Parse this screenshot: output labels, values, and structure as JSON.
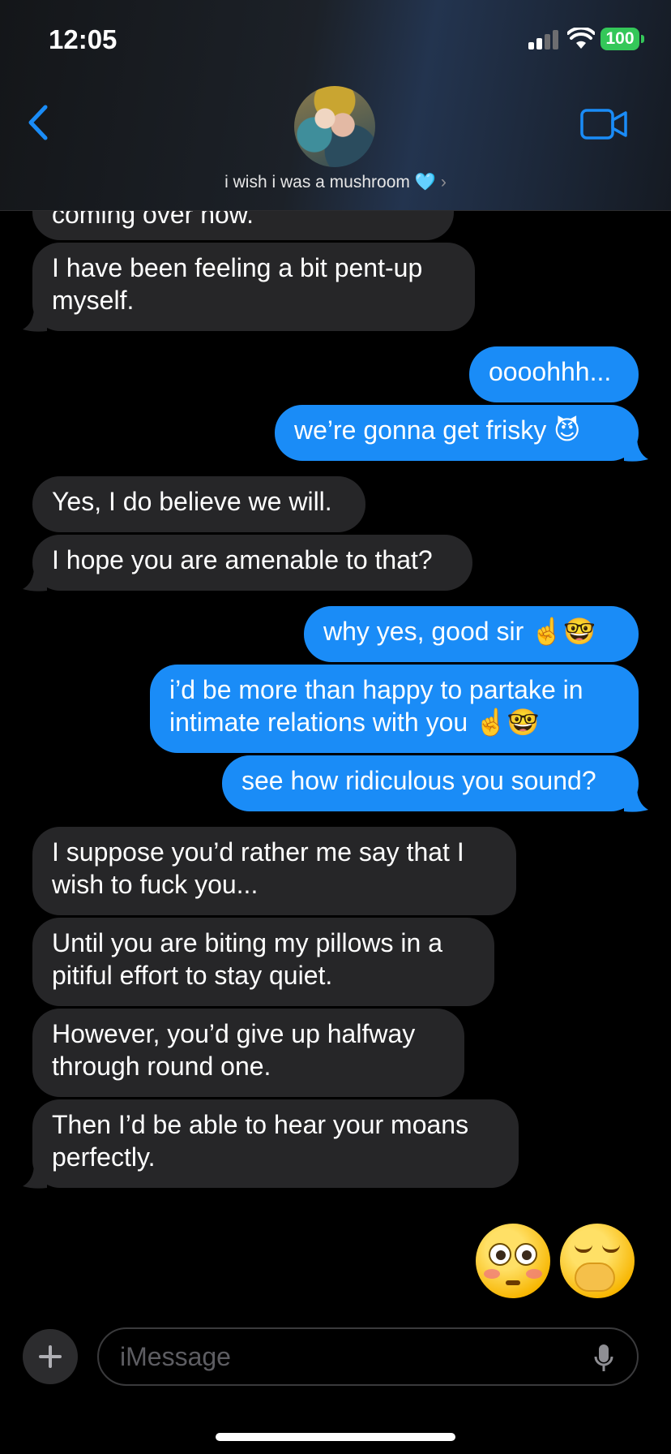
{
  "status_bar": {
    "time": "12:05",
    "battery": "100"
  },
  "header": {
    "contact_name": "i wish i was a mushroom 🩵",
    "chevron": "›"
  },
  "messages": [
    {
      "side": "received",
      "text": "coming over now."
    },
    {
      "side": "received",
      "text": "I have been feeling a bit pent-up\nmyself."
    },
    {
      "side": "sent",
      "text": "oooohhh..."
    },
    {
      "side": "sent",
      "text": "we’re gonna get frisky 😈"
    },
    {
      "side": "received",
      "text": "Yes, I do believe we will."
    },
    {
      "side": "received",
      "text": "I hope you are amenable to that?"
    },
    {
      "side": "sent",
      "text": "why yes, good sir ☝️🤓"
    },
    {
      "side": "sent",
      "text": "i’d be more than happy to partake in\nintimate relations with you ☝️🤓"
    },
    {
      "side": "sent",
      "text": "see how ridiculous you sound?"
    },
    {
      "side": "received",
      "text": "I suppose you’d rather me say that I\nwish to fuck you..."
    },
    {
      "side": "received",
      "text": "Until you are biting my pillows in a\npitiful effort to stay quiet."
    },
    {
      "side": "received",
      "text": "However, you’d give up halfway\nthrough round one."
    },
    {
      "side": "received",
      "text": "Then I’d be able to hear your moans\nperfectly."
    }
  ],
  "big_emojis": [
    "flushed-face",
    "face-with-hand-over-mouth"
  ],
  "composer": {
    "placeholder": "iMessage"
  },
  "colors": {
    "sent_bubble": "#1a8cf7",
    "received_bubble": "#262628",
    "accent": "#1a8cf7"
  }
}
